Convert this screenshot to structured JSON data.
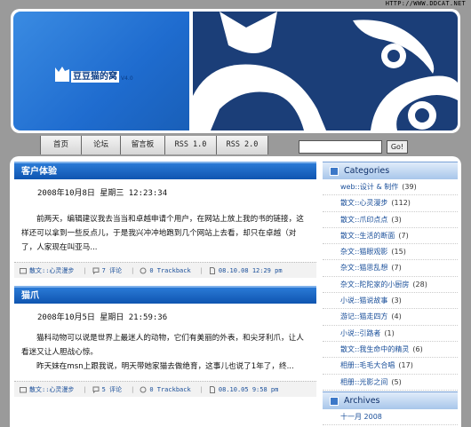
{
  "site": {
    "url_text": "HTTP://WWW.DDCAT.NET",
    "logo_text": "豆豆猫的窝",
    "logo_version": "V4.0"
  },
  "nav": {
    "items": [
      "首页",
      "论坛",
      "留言板",
      "RSS 1.0",
      "RSS 2.0"
    ],
    "search_placeholder": "",
    "go_label": "Go!"
  },
  "posts": [
    {
      "title": "客户体验",
      "date": "2008年10月8日  星期三  12:23:34",
      "body": "前两天，编辑建议我去当当和卓越申请个用户，在网站上放上我的书的链接，这样还可以拿到一些反点儿，于是我兴冲冲地跑到几个网站上去看，却只在卓越（对了，人家现在叫亚马...",
      "category": "散文::心灵漫步",
      "comments": "7 评论",
      "trackback": "0 Trackback",
      "time": "08.10.08 12:29 pm"
    },
    {
      "title": "猫爪",
      "date": "2008年10月5日  星期日  21:59:36",
      "body_lines": [
        "猫科动物可以说是世界上最迷人的动物，它们有美丽的外表，和尖牙利爪，让人看迷又让人胆战心惊。",
        "昨天妹在msn上跟我说，明天带她家猫去做绝育，这事儿也说了1年了，终..."
      ],
      "category": "散文::心灵漫步",
      "comments": "5 评论",
      "trackback": "0 Trackback",
      "time": "08.10.05 9:58 pm"
    }
  ],
  "sidebar": {
    "categories_title": "Categories",
    "categories": [
      {
        "name": "web::设计 & 制作",
        "count": "(39)"
      },
      {
        "name": "散文::心灵漫步",
        "count": "(112)"
      },
      {
        "name": "散文::爪印点点",
        "count": "(3)"
      },
      {
        "name": "散文::生活的断面",
        "count": "(7)"
      },
      {
        "name": "杂文::猫眼观影",
        "count": "(15)"
      },
      {
        "name": "杂文::猫思乱想",
        "count": "(7)"
      },
      {
        "name": "杂文::陀陀家的小厨房",
        "count": "(28)"
      },
      {
        "name": "小说::猫说故事",
        "count": "(3)"
      },
      {
        "name": "游记::猫走四方",
        "count": "(4)"
      },
      {
        "name": "小说::引路者",
        "count": "(1)"
      },
      {
        "name": "散文::我生命中的精灵",
        "count": "(6)"
      },
      {
        "name": "相册::毛毛大合唱",
        "count": "(17)"
      },
      {
        "name": "相册::光影之间",
        "count": "(5)"
      }
    ],
    "archives_title": "Archives",
    "archives": [
      "十一月 2008"
    ]
  },
  "colors": {
    "brand_blue": "#1f6ccf",
    "header_dark": "#1b3e78",
    "title_bar": "#0f55b0"
  }
}
